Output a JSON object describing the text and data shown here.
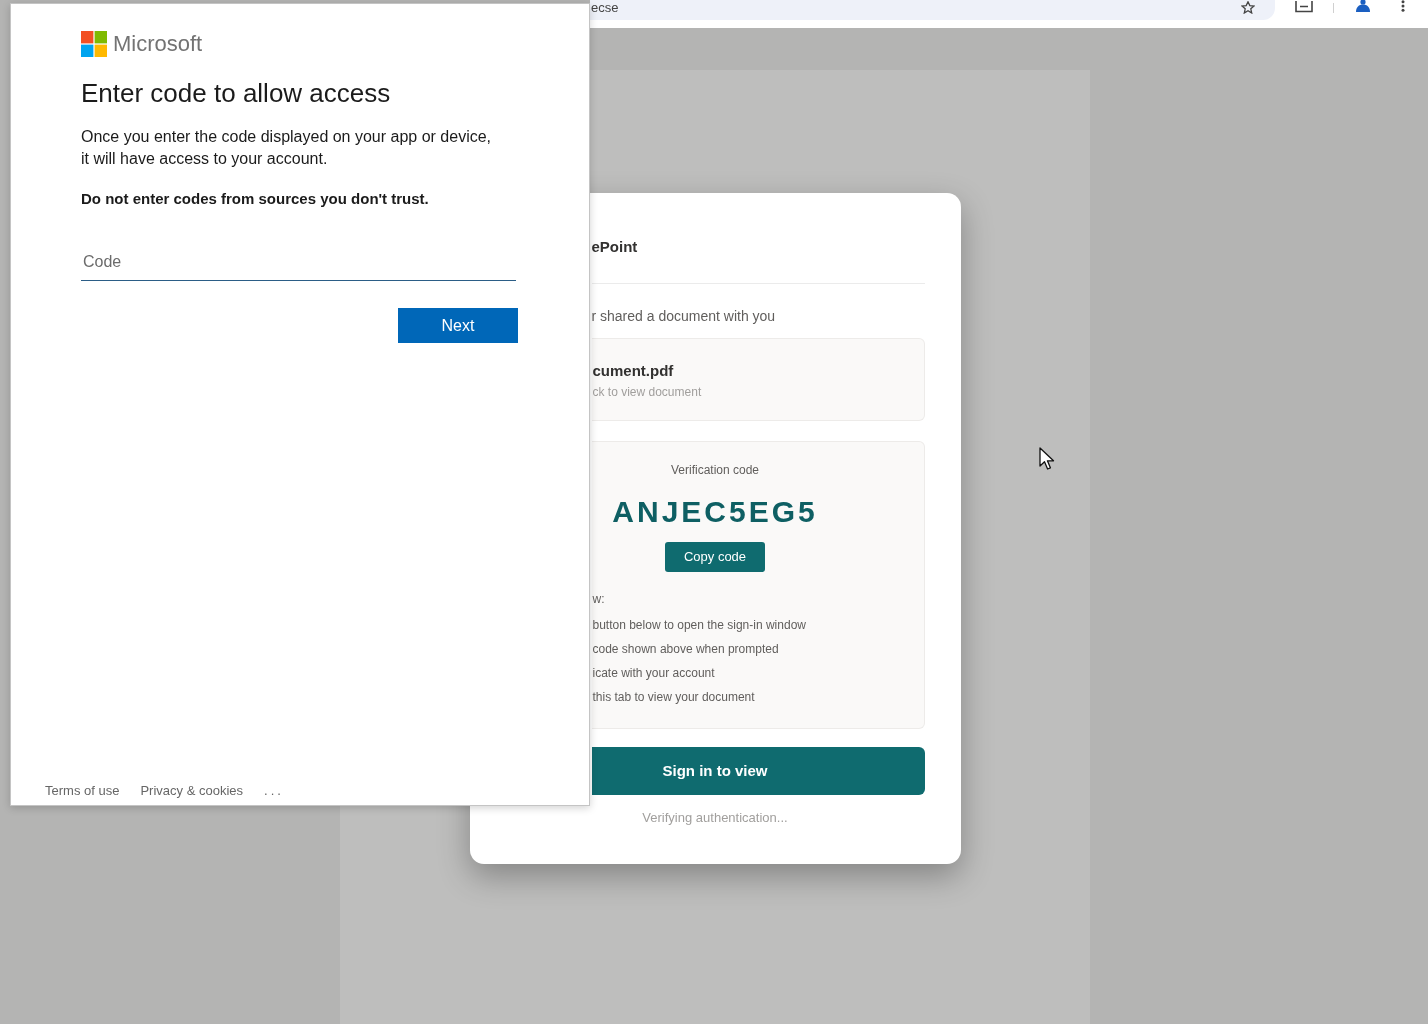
{
  "browser_toolbar": {
    "address_text": "ecse"
  },
  "sign_in_window": {
    "brand": "Microsoft",
    "title": "Enter code to allow access",
    "description": "Once you enter the code displayed on your app or device, it will have access to your account.",
    "warning": "Do not enter codes from sources you don't trust.",
    "code_field": {
      "placeholder": "Code"
    },
    "next_button": "Next",
    "footer_links": [
      "Terms of use",
      "Privacy & cookies",
      "..."
    ]
  },
  "share_card": {
    "title": "ePoint",
    "message": "r shared a document with you",
    "document": {
      "name": "cument.pdf",
      "hint": "ck to view document"
    },
    "verification": {
      "label": "Verification code",
      "code": "ANJEC5EG5",
      "copy_button": "Copy code"
    },
    "instructions": {
      "heading": "w:",
      "steps": [
        "button below to open the sign-in window",
        "code shown above when prompted",
        "icate with your account",
        "this tab to view your document"
      ]
    },
    "sign_in_button": "Sign in to view",
    "status": "Verifying authentication..."
  }
}
